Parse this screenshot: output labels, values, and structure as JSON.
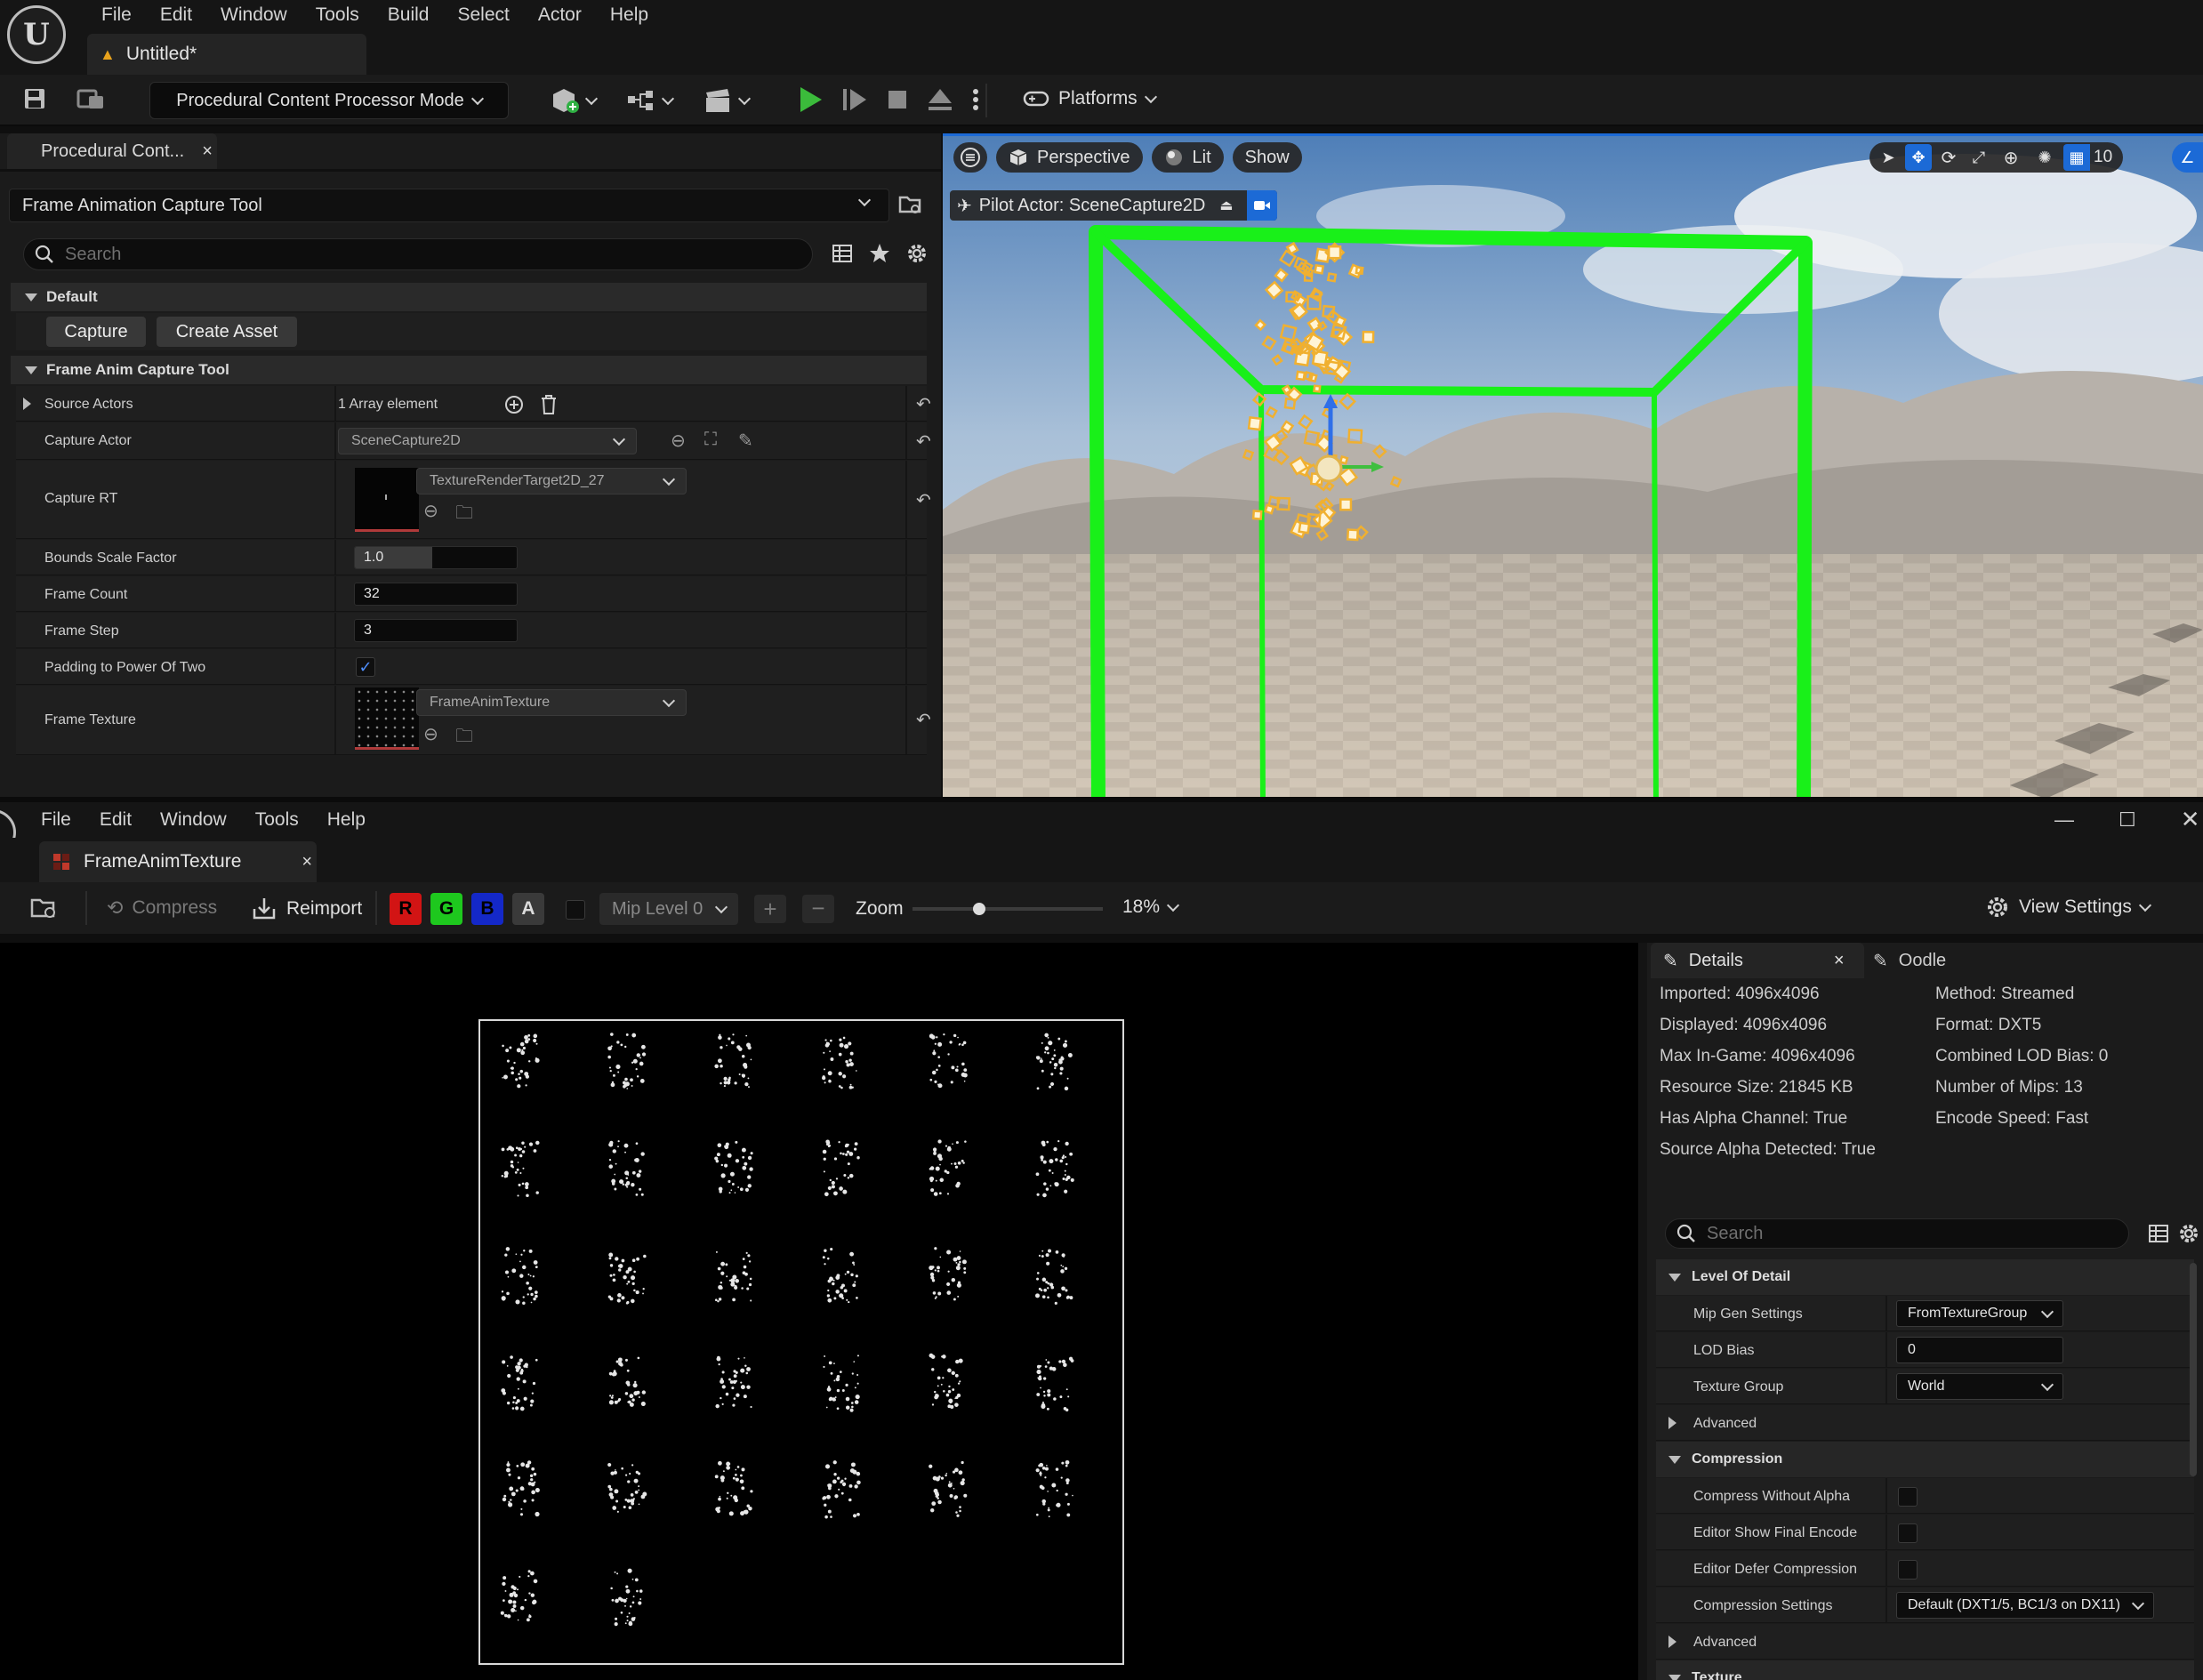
{
  "editor": {
    "menu": [
      "File",
      "Edit",
      "Window",
      "Tools",
      "Build",
      "Select",
      "Actor",
      "Help"
    ],
    "doc_tab": "Untitled*",
    "mode": "Procedural Content Processor Mode",
    "platforms": "Platforms"
  },
  "panel": {
    "tab": "Procedural Cont...",
    "tool_selector": "Frame Animation Capture Tool",
    "search_placeholder": "Search",
    "default_section": "Default",
    "capture_button": "Capture",
    "create_asset_button": "Create Asset",
    "tool_section": "Frame Anim Capture Tool",
    "props": {
      "source_actors": {
        "label": "Source Actors",
        "value": "1 Array element"
      },
      "capture_actor": {
        "label": "Capture Actor",
        "value": "SceneCapture2D"
      },
      "capture_rt": {
        "label": "Capture RT",
        "value": "TextureRenderTarget2D_27"
      },
      "bounds_scale": {
        "label": "Bounds Scale Factor",
        "value": "1.0",
        "fill_fraction": 0.48
      },
      "frame_count": {
        "label": "Frame Count",
        "value": "32"
      },
      "frame_step": {
        "label": "Frame Step",
        "value": "3"
      },
      "padding_pow2": {
        "label": "Padding to Power Of Two",
        "checked": true
      },
      "frame_texture": {
        "label": "Frame Texture",
        "value": "FrameAnimTexture"
      }
    }
  },
  "viewport": {
    "view_mode": "Perspective",
    "lighting": "Lit",
    "show": "Show",
    "pilot": "Pilot Actor: SceneCapture2D",
    "grid_snap": "10",
    "colors": {
      "bounds": "#19f019",
      "particle": "#f0b030",
      "active": "#1c6ad6"
    }
  },
  "texture_editor": {
    "menu": [
      "File",
      "Edit",
      "Window",
      "Tools",
      "Help"
    ],
    "tab": "FrameAnimTexture",
    "compress": "Compress",
    "reimport": "Reimport",
    "channels": [
      {
        "label": "R",
        "color": "#d21414"
      },
      {
        "label": "G",
        "color": "#1ec81e"
      },
      {
        "label": "B",
        "color": "#1428c8"
      },
      {
        "label": "A",
        "color": "#9a9a9a"
      }
    ],
    "mip_level": "Mip Level 0",
    "zoom_label": "Zoom",
    "zoom_value": "18%",
    "zoom_fraction": 0.35,
    "view_settings": "View Settings",
    "atlas": {
      "columns": 6,
      "rows": 6,
      "frames": 32
    }
  },
  "details": {
    "tab_details": "Details",
    "tab_oodle": "Oodle",
    "info_left": [
      "Imported: 4096x4096",
      "Displayed: 4096x4096",
      "Max In-Game: 4096x4096",
      "Resource Size: 21845 KB",
      "Has Alpha Channel: True",
      "Source Alpha Detected: True"
    ],
    "info_right": [
      "Method: Streamed",
      "Format: DXT5",
      "Combined LOD Bias: 0",
      "Number of Mips: 13",
      "Encode Speed: Fast"
    ],
    "search_placeholder": "Search",
    "lod_section": "Level Of Detail",
    "mip_gen": {
      "label": "Mip Gen Settings",
      "value": "FromTextureGroup"
    },
    "lod_bias": {
      "label": "LOD Bias",
      "value": "0"
    },
    "texture_group": {
      "label": "Texture Group",
      "value": "World"
    },
    "advanced_1": "Advanced",
    "compression_section": "Compression",
    "compress_without_alpha": "Compress Without Alpha",
    "show_final_encode": "Editor Show Final Encode",
    "defer_compression": "Editor Defer Compression",
    "compression_settings": {
      "label": "Compression Settings",
      "value": "Default (DXT1/5, BC1/3 on DX11)"
    },
    "advanced_2": "Advanced",
    "texture_section": "Texture"
  }
}
